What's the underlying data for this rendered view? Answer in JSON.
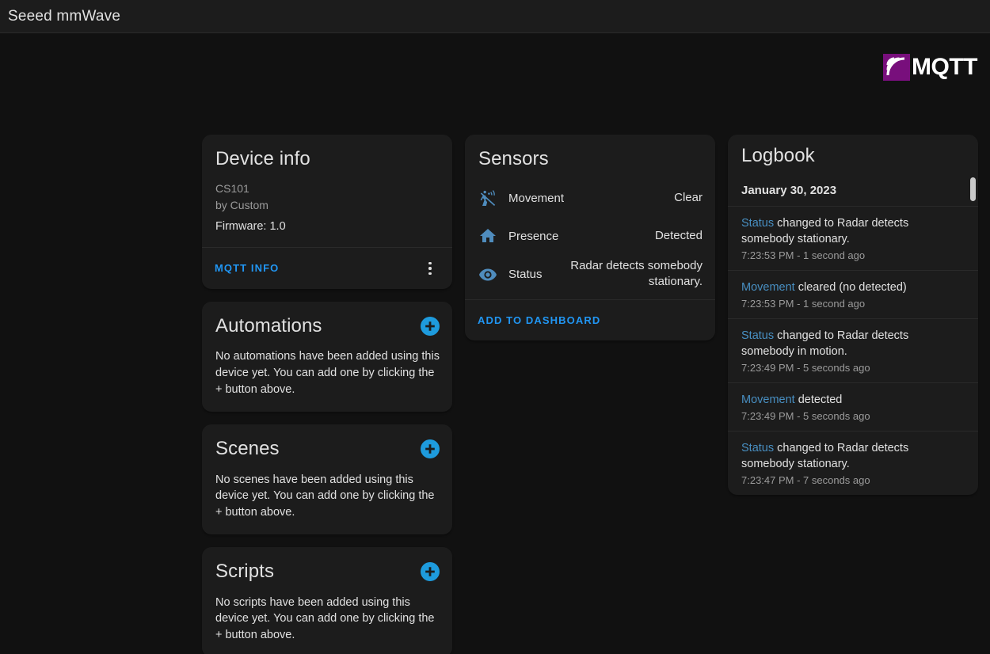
{
  "header": {
    "title": "Seeed mmWave"
  },
  "brand": {
    "logo_name": "mqtt-logo",
    "wordmark": "MQTT",
    "mark_color": "#780f7c"
  },
  "theme": {
    "page_bg": "#111111",
    "card_bg": "#1c1c1c",
    "accent_blue": "#2196f3",
    "add_button_blue": "#1e9bdd",
    "icon_blue": "#4f8cbd",
    "text_primary": "#e1e1e1",
    "text_secondary": "#9b9b9b",
    "divider": "#2a2a2a"
  },
  "device_info": {
    "title": "Device info",
    "model": "CS101",
    "manufacturer": "by Custom",
    "firmware": "Firmware: 1.0",
    "mqtt_info_label": "MQTT INFO",
    "overflow_icon": "more-vertical-icon"
  },
  "automations": {
    "title": "Automations",
    "add_icon": "plus-circle-icon",
    "empty_text": "No automations have been added using this device yet. You can add one by clicking the + button above."
  },
  "scenes": {
    "title": "Scenes",
    "add_icon": "plus-circle-icon",
    "empty_text": "No scenes have been added using this device yet. You can add one by clicking the + button above."
  },
  "scripts": {
    "title": "Scripts",
    "add_icon": "plus-circle-icon",
    "empty_text": "No scripts have been added using this device yet. You can add one by clicking the + button above."
  },
  "sensors": {
    "title": "Sensors",
    "add_to_dashboard_label": "ADD TO DASHBOARD",
    "rows": [
      {
        "icon": "motion-sensor-off-icon",
        "name": "Movement",
        "value": "Clear"
      },
      {
        "icon": "home-icon",
        "name": "Presence",
        "value": "Detected"
      },
      {
        "icon": "eye-icon",
        "name": "Status",
        "value": "Radar detects somebody stationary."
      }
    ]
  },
  "logbook": {
    "title": "Logbook",
    "date": "January 30, 2023",
    "entries": [
      {
        "entity": "Status",
        "message": " changed to Radar detects somebody stationary.",
        "time": "7:23:53 PM - 1 second ago"
      },
      {
        "entity": "Movement",
        "message": " cleared (no detected)",
        "time": "7:23:53 PM - 1 second ago"
      },
      {
        "entity": "Status",
        "message": " changed to Radar detects somebody in motion.",
        "time": "7:23:49 PM - 5 seconds ago"
      },
      {
        "entity": "Movement",
        "message": " detected",
        "time": "7:23:49 PM - 5 seconds ago"
      },
      {
        "entity": "Status",
        "message": " changed to Radar detects somebody stationary.",
        "time": "7:23:47 PM - 7 seconds ago"
      }
    ]
  }
}
